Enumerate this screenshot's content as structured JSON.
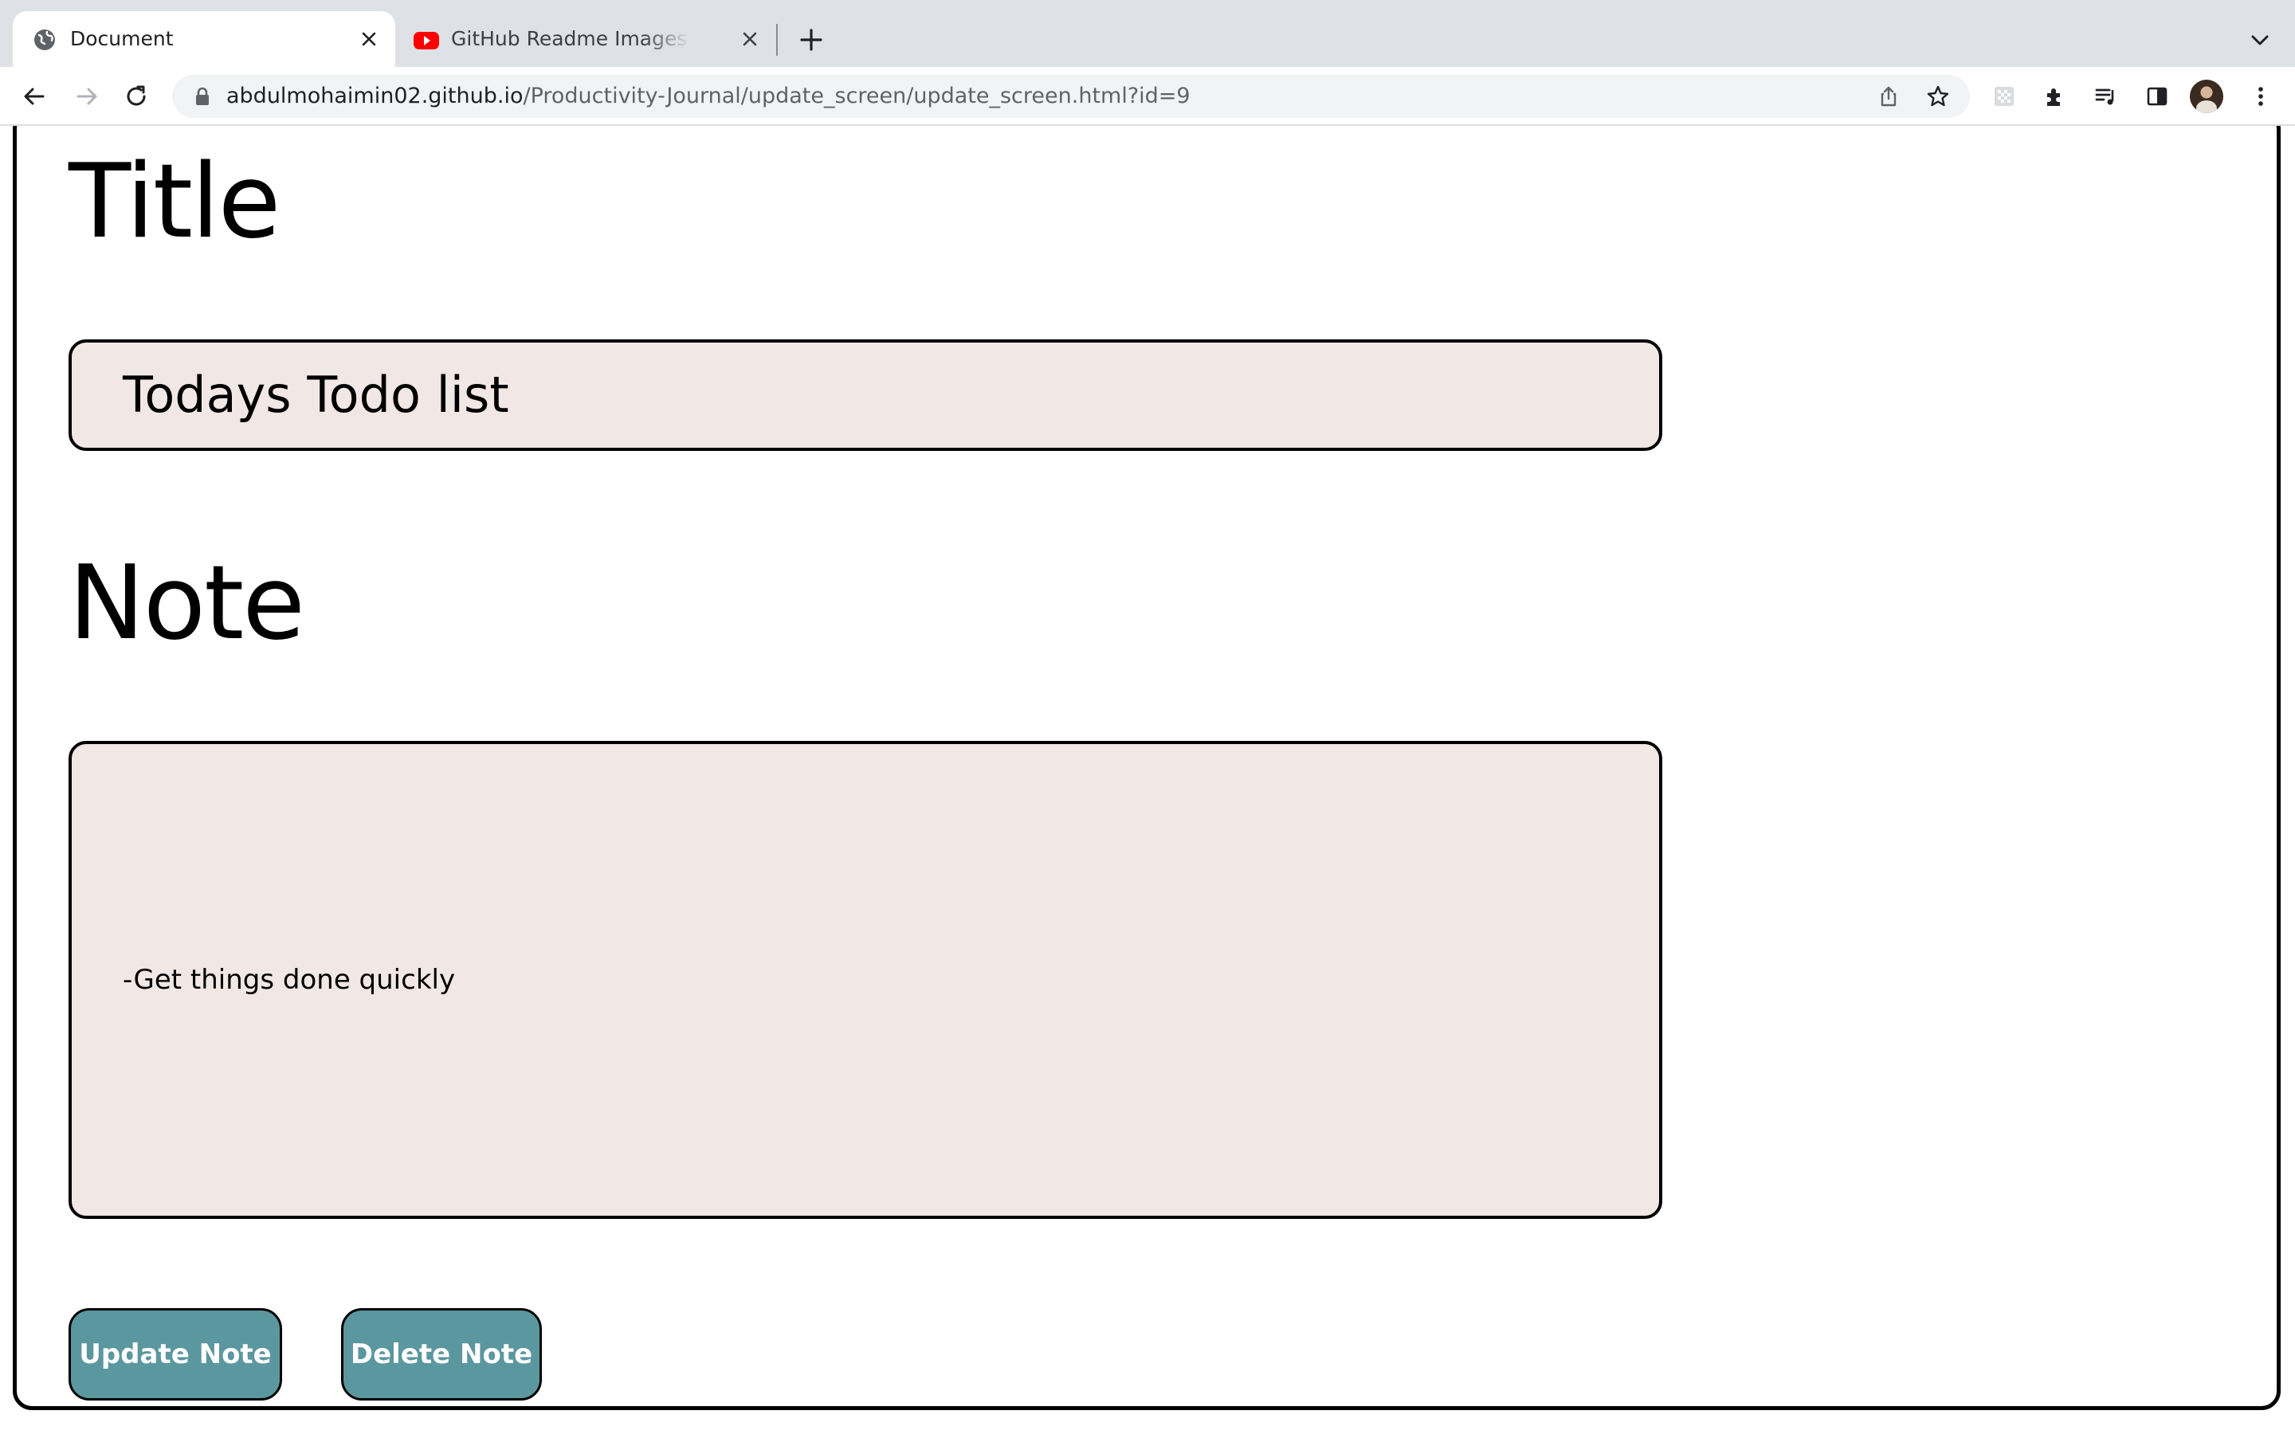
{
  "browser": {
    "tabs": [
      {
        "title": "Document",
        "favicon": "globe-icon",
        "active": true
      },
      {
        "title": "GitHub Readme Images Tutorial",
        "favicon": "youtube-icon",
        "active": false
      }
    ],
    "url_host": "abdulmohaimin02.github.io",
    "url_path": "/Productivity-Journal/update_screen/update_screen.html?id=9"
  },
  "page": {
    "title_heading": "Title",
    "title_value": "Todays Todo list",
    "note_heading": "Note",
    "note_value": "-Get things done quickly",
    "update_button": "Update Note",
    "delete_button": "Delete Note"
  },
  "colors": {
    "field_background": "#f1e7e5",
    "button_background": "#5b979f",
    "tabbar_background": "#dee1e6"
  }
}
